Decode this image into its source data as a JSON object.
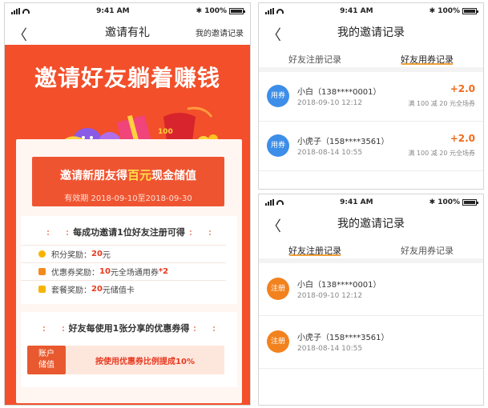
{
  "screen1": {
    "status": {
      "time": "9:41 AM",
      "battery": "100%"
    },
    "nav": {
      "back": "〈",
      "title": "邀请有礼",
      "right_link": "我的邀请记录"
    },
    "hero_title": "邀请好友躺着赚钱",
    "banner": {
      "text_before": "邀请新朋友得",
      "highlight": "百元",
      "text_after": "现金储值",
      "date_range": "有效期  2018-09-10至2018-09-30"
    },
    "reward_section": {
      "heading": "每成功邀请1位好友注册可得",
      "rows": [
        {
          "label": "积分奖励：",
          "value": "20",
          "suffix": "元",
          "extra": ""
        },
        {
          "label": "优惠券奖励：",
          "value": "10",
          "suffix": "元全场通用券",
          "extra": "*2"
        },
        {
          "label": "套餐奖励：",
          "value": "20",
          "suffix": "元储值卡",
          "extra": ""
        }
      ]
    },
    "share_section": {
      "heading": "好友每使用1张分享的优惠券得",
      "tag_line1": "账户",
      "tag_line2": "储值",
      "text": "按使用优惠券比例提成10%"
    },
    "gift_label": "100",
    "colors": {
      "primary": "#f24f2a",
      "accent": "#ffe04a"
    }
  },
  "screen2": {
    "status": {
      "time": "9:41 AM",
      "battery": "100%"
    },
    "nav": {
      "back": "〈",
      "title": "我的邀请记录"
    },
    "tabs": [
      {
        "label": "好友注册记录",
        "active": false
      },
      {
        "label": "好友用券记录",
        "active": true
      }
    ],
    "items": [
      {
        "badge": "用券",
        "name": "小白（138****0001）",
        "date": "2018-09-10 12:12",
        "amount": "+2.0",
        "note": "满 100 减 20 元全场券"
      },
      {
        "badge": "用券",
        "name": "小虎子（158****3561）",
        "date": "2018-08-14 10:55",
        "amount": "+2.0",
        "note": "满 100 减 20 元全场券"
      }
    ]
  },
  "screen3": {
    "status": {
      "time": "9:41 AM",
      "battery": "100%"
    },
    "nav": {
      "back": "〈",
      "title": "我的邀请记录"
    },
    "tabs": [
      {
        "label": "好友注册记录",
        "active": true
      },
      {
        "label": "好友用券记录",
        "active": false
      }
    ],
    "items": [
      {
        "badge": "注册",
        "name": "小白（138****0001）",
        "date": "2018-09-10 12:12"
      },
      {
        "badge": "注册",
        "name": "小虎子（158****3561）",
        "date": "2018-08-14 10:55"
      }
    ]
  }
}
